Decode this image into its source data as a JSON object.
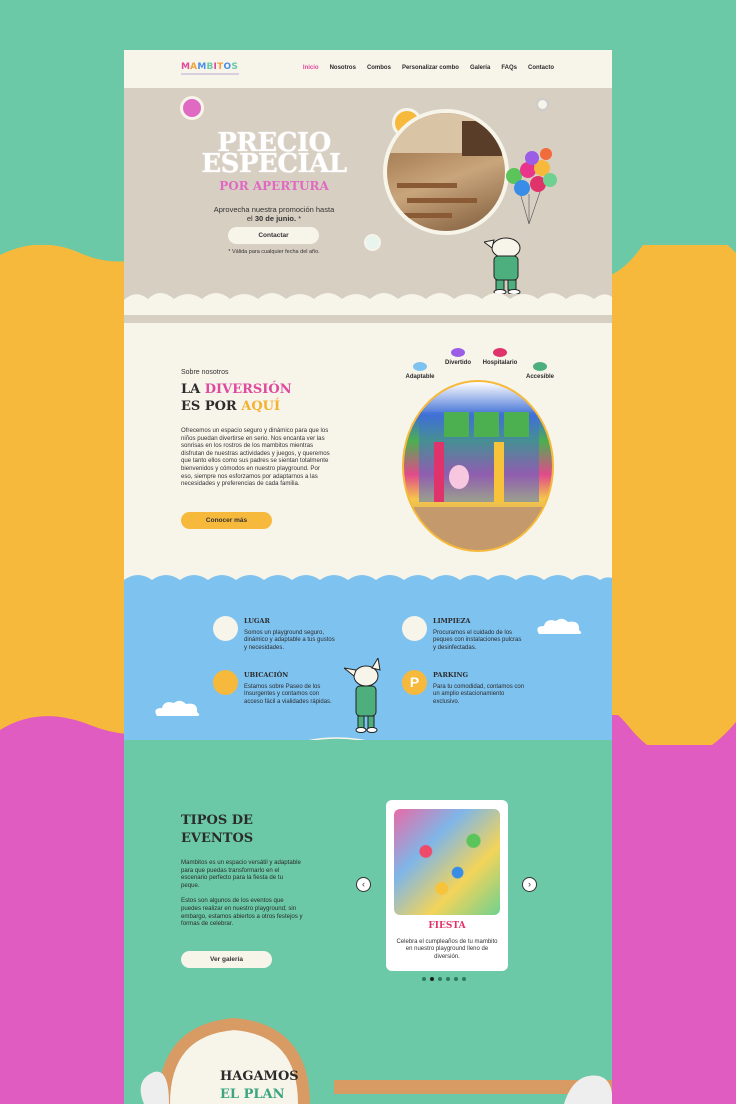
{
  "nav": {
    "logo": "MAMBITOS",
    "links": [
      "Inicio",
      "Nosotros",
      "Combos",
      "Personalizar combo",
      "Galería",
      "FAQs",
      "Contacto"
    ],
    "active": "Inicio"
  },
  "hero": {
    "title_line1": "PRECIO",
    "title_line2": "ESPECIAL",
    "subtitle": "POR APERTURA",
    "text_prefix": "Aprovecha nuestra promoción hasta el ",
    "text_bold": "30 de junio.",
    "text_suffix": " *",
    "button": "Contactar",
    "note": "* Válida para cualquier fecha del año."
  },
  "about": {
    "label": "Sobre nosotros",
    "title_word1": "LA ",
    "title_word2": "DIVERSIÓN",
    "title_word3": "ES POR ",
    "title_word4": "AQUÍ",
    "body": "Ofrecemos un espacio seguro y dinámico para que los niños puedan divertirse en serio. Nos encanta ver las sonrisas en los rostros de los mambitos mientras disfrutan de nuestras actividades y juegos, y queremos que tanto ellos como sus padres se sientan totalmente bienvenidos y cómodos en nuestro playground. Por eso, siempre nos esforzamos por adaptarnos a las necesidades y preferencias de cada familia.",
    "button": "Conocer más",
    "features": [
      "Adaptable",
      "Divertido",
      "Hospitalario",
      "Accesible"
    ]
  },
  "services": [
    {
      "title": "LUGAR",
      "body": "Somos un playground seguro, dinámico y adaptable a tus gustos y necesidades."
    },
    {
      "title": "LIMPIEZA",
      "body": "Procuramos el cuidado de los peques con instalaciones pulcras y desinfectadas."
    },
    {
      "title": "UBICACIÓN",
      "body": "Estamos sobre Paseo de los Insurgentes y contamos con acceso fácil a vialidades rápidas."
    },
    {
      "title": "PARKING",
      "body": "Para tu comodidad, contamos con un amplio estacionamiento exclusivo."
    }
  ],
  "events": {
    "title_line1": "TIPOS DE",
    "title_line2": "EVENTOS",
    "body1": "Mambitos es un espacio versátil y adaptable para que puedas transformarlo en el escenario perfecto para la fiesta de tu peque.",
    "body2": "Estos son algunos de los eventos que puedes realizar en nuestro playground; sin embargo, estamos abiertos a otros festejos y formas de celebrar.",
    "button": "Ver galería",
    "card_title": "FIESTA",
    "card_body": "Celebra el cumpleaños de tu mambito en nuestro playground lleno de diversión.",
    "prev": "‹",
    "next": "›",
    "slides": 6,
    "current_slide": 2
  },
  "bottom": {
    "title_line1": "HAGAMOS",
    "title_line2": "EL PLAN"
  },
  "colors": {
    "teal": "#6bc9a8",
    "yellow": "#f6b93b",
    "pink": "#e05cc0",
    "blue": "#7ec2f0",
    "cream": "#f7f4ea"
  }
}
